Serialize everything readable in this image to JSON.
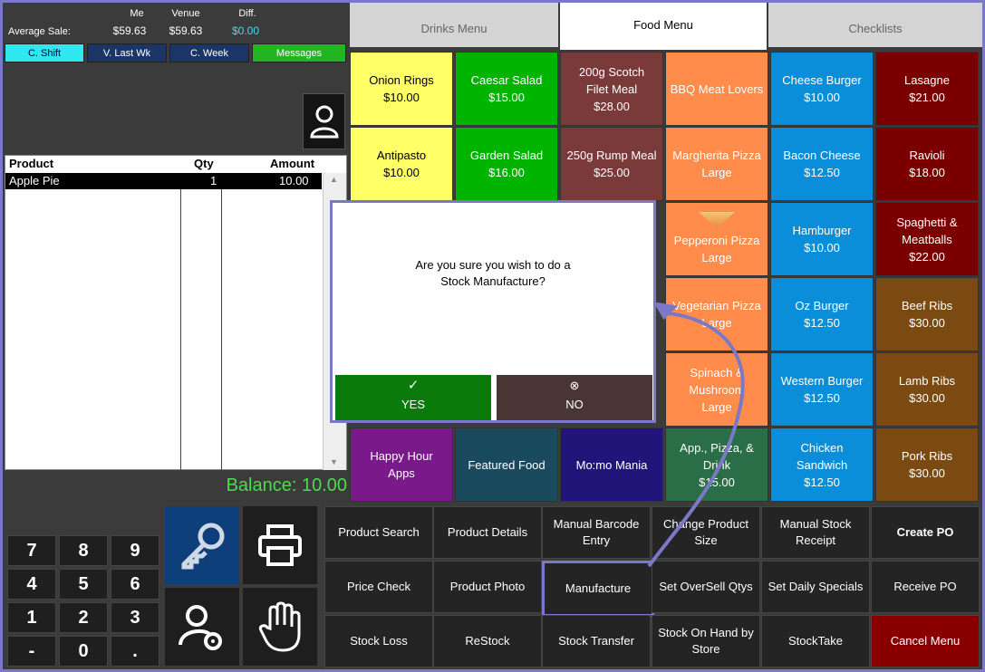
{
  "stats": {
    "col_me": "Me",
    "col_venue": "Venue",
    "col_diff": "Diff.",
    "label": "Average Sale:",
    "me": "$59.63",
    "venue": "$59.63",
    "diff": "$0.00"
  },
  "shift_buttons": [
    "C. Shift",
    "V. Last Wk",
    "C. Week",
    "Messages"
  ],
  "order": {
    "headers": {
      "product": "Product",
      "qty": "Qty",
      "amount": "Amount"
    },
    "rows": [
      {
        "product": "Apple Pie",
        "qty": "1",
        "amount": "10.00"
      }
    ],
    "balance": "Balance: 10.00"
  },
  "tabs": [
    "Drinks Menu",
    "Food Menu",
    "Checklists"
  ],
  "menu": {
    "r0": [
      {
        "l1": "Onion Rings",
        "l2": "$10.00"
      },
      {
        "l1": "Caesar Salad",
        "l2": "$15.00"
      },
      {
        "l1": "200g Scotch",
        "l2": "Filet Meal",
        "l3": "$28.00"
      },
      {
        "l1": "BBQ Meat Lovers"
      },
      {
        "l1": "Cheese Burger",
        "l2": "$10.00"
      },
      {
        "l1": "Lasagne",
        "l2": "$21.00"
      }
    ],
    "r1": [
      {
        "l1": "Antipasto",
        "l2": "$10.00"
      },
      {
        "l1": "Garden Salad",
        "l2": "$16.00"
      },
      {
        "l1": "250g Rump Meal",
        "l2": "$25.00"
      },
      {
        "l1": "Margherita Pizza",
        "l2": "Large"
      },
      {
        "l1": "Bacon Cheese",
        "l2": "$12.50"
      },
      {
        "l1": "Ravioli",
        "l2": "$18.00"
      }
    ],
    "r2": [
      {
        "l1": "Pepperoni Pizza",
        "l2": "Large"
      },
      {
        "l1": "Hamburger",
        "l2": "$10.00"
      },
      {
        "l1": "Spaghetti &",
        "l2": "Meatballs",
        "l3": "$22.00"
      }
    ],
    "r3": [
      {
        "l1": "Vegetarian Pizza",
        "l2": "Large"
      },
      {
        "l1": "Oz Burger",
        "l2": "$12.50"
      },
      {
        "l1": "Beef Ribs",
        "l2": "$30.00"
      }
    ],
    "r4": [
      {
        "l1": "Spinach &",
        "l2": "Mushroom",
        "l3": "Large"
      },
      {
        "l1": "Western Burger",
        "l2": "$12.50"
      },
      {
        "l1": "Lamb Ribs",
        "l2": "$30.00"
      }
    ],
    "r5": [
      {
        "l1": "Happy Hour",
        "l2": "Apps"
      },
      {
        "l1": "Featured Food"
      },
      {
        "l1": "Mo:mo Mania"
      },
      {
        "l1": "App., Pizza, &",
        "l2": "Drink",
        "l3": "$15.00"
      },
      {
        "l1": "Chicken",
        "l2": "Sandwich",
        "l3": "$12.50"
      },
      {
        "l1": "Pork Ribs",
        "l2": "$30.00"
      }
    ]
  },
  "dialog": {
    "line1": "Are you sure you wish to do a",
    "line2": "Stock Manufacture?",
    "yes": "YES",
    "no": "NO"
  },
  "functions": {
    "r0": [
      {
        "l1": "Product Search"
      },
      {
        "l1": "Product Details"
      },
      {
        "l1": "Manual Barcode",
        "l2": "Entry"
      },
      {
        "l1": "Change Product",
        "l2": "Size"
      },
      {
        "l1": "Manual Stock",
        "l2": "Receipt"
      },
      {
        "l1": "Create PO"
      }
    ],
    "r1": [
      {
        "l1": "Price Check"
      },
      {
        "l1": "Product Photo"
      },
      {
        "l1": "Manufacture"
      },
      {
        "l1": "Set OverSell Qtys"
      },
      {
        "l1": "Set Daily Specials"
      },
      {
        "l1": "Receive PO"
      }
    ],
    "r2": [
      {
        "l1": "Stock Loss"
      },
      {
        "l1": "ReStock"
      },
      {
        "l1": "Stock Transfer"
      },
      {
        "l1": "Stock On Hand by",
        "l2": "Store"
      },
      {
        "l1": "StockTake"
      },
      {
        "l1": "Cancel Menu"
      }
    ]
  },
  "keypad": [
    "7",
    "8",
    "9",
    "4",
    "5",
    "6",
    "1",
    "2",
    "3",
    "-",
    "0",
    "."
  ],
  "colors": {
    "yellow": "#ffff66",
    "green": "#00b400",
    "maroon": "#7a3a3a",
    "orange": "#ff8c4a",
    "blue": "#0a8ed9",
    "darkred": "#7a0000",
    "brown": "#7a4a12",
    "purple": "#7a1a8a",
    "teal": "#1a4a5e",
    "indigo": "#22157a",
    "darkgreen": "#2a6e48",
    "accent": "#7b78c8",
    "yes": "#0a7a0a",
    "no": "#4a3535"
  }
}
